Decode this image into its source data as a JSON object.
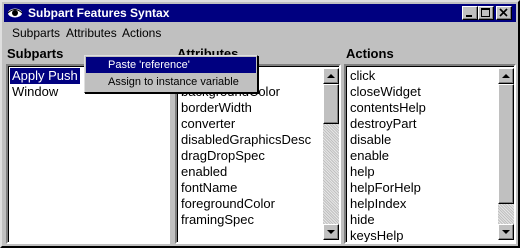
{
  "window": {
    "title": "Subpart Features Syntax"
  },
  "menubar": {
    "items": [
      "Subparts",
      "Attributes",
      "Actions"
    ]
  },
  "panes": {
    "subparts": {
      "label": "Subparts",
      "items": [
        "Apply Push",
        "Window"
      ],
      "selected_index": 0
    },
    "attributes": {
      "label": "Attributes",
      "items": [
        "backgroundColor",
        "borderWidth",
        "converter",
        "disabledGraphicsDesc",
        "dragDropSpec",
        "enabled",
        "fontName",
        "foregroundColor",
        "framingSpec"
      ]
    },
    "actions": {
      "label": "Actions",
      "items": [
        "click",
        "closeWidget",
        "contentsHelp",
        "destroyPart",
        "disable",
        "enable",
        "help",
        "helpForHelp",
        "helpIndex",
        "hide",
        "keysHelp"
      ]
    }
  },
  "context_menu": {
    "items": [
      "Paste 'reference'",
      "Assign to instance variable"
    ],
    "active_index": 0
  },
  "colors": {
    "titlebar": "#000080",
    "selection": "#000080",
    "face": "#c0c0c0"
  }
}
